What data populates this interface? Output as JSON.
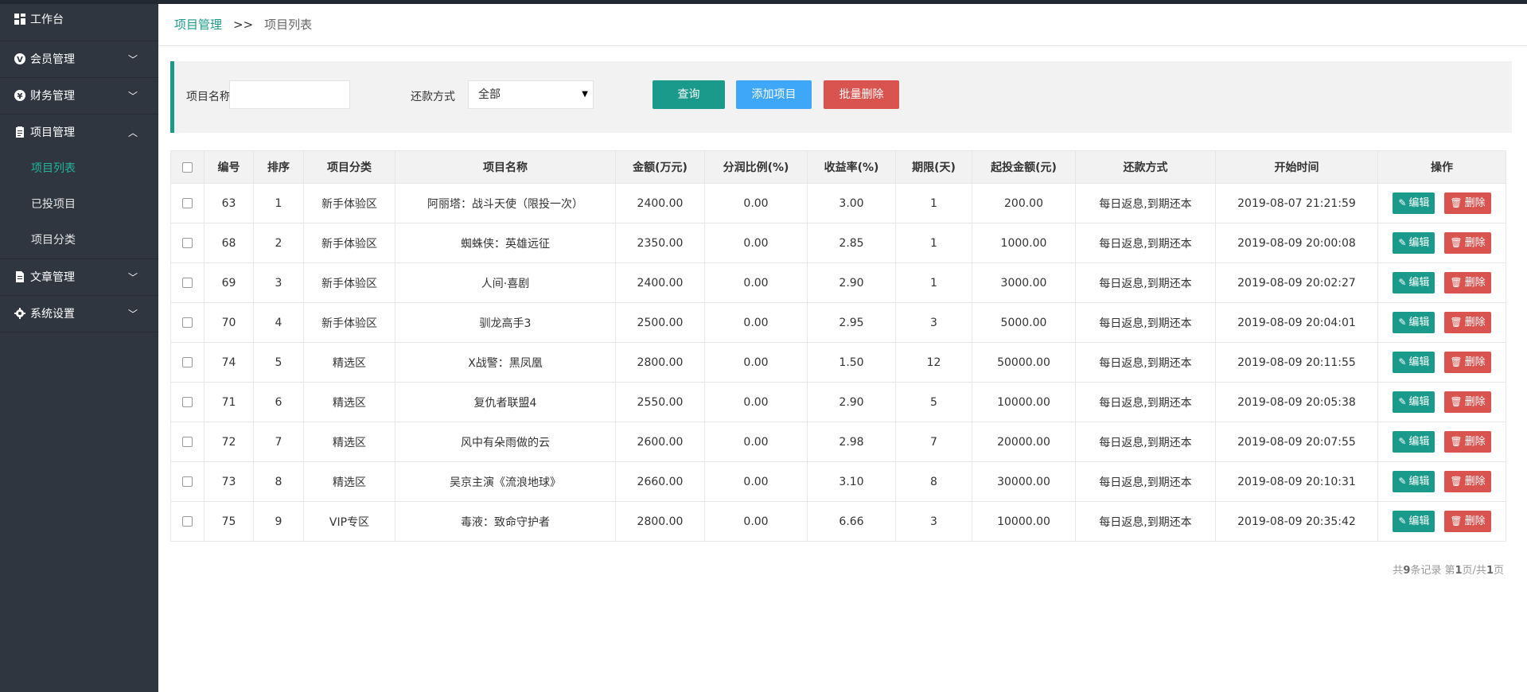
{
  "sidebar": {
    "items": [
      {
        "label": "工作台",
        "icon": "dashboard-icon"
      },
      {
        "label": "会员管理",
        "icon": "member-icon"
      },
      {
        "label": "财务管理",
        "icon": "finance-icon"
      },
      {
        "label": "项目管理",
        "icon": "clipboard-icon"
      },
      {
        "label": "文章管理",
        "icon": "file-icon"
      },
      {
        "label": "系统设置",
        "icon": "gear-icon"
      }
    ],
    "sub_items": [
      {
        "label": "项目列表"
      },
      {
        "label": "已投项目"
      },
      {
        "label": "项目分类"
      }
    ]
  },
  "breadcrumb": {
    "root": "项目管理",
    "sep": ">>",
    "current": "项目列表"
  },
  "filter": {
    "name_label": "项目名称",
    "name_value": "",
    "repay_label": "还款方式",
    "repay_value": "全部",
    "query": "查询",
    "add": "添加项目",
    "batch_delete": "批量删除"
  },
  "table": {
    "headers": [
      "编号",
      "排序",
      "项目分类",
      "项目名称",
      "金额(万元)",
      "分润比例(%)",
      "收益率(%)",
      "期限(天)",
      "起投金额(元)",
      "还款方式",
      "开始时间",
      "操作"
    ],
    "edit_label": "编辑",
    "delete_label": "删除",
    "rows": [
      [
        "63",
        "1",
        "新手体验区",
        "阿丽塔：战斗天使（限投一次）",
        "2400.00",
        "0.00",
        "3.00",
        "1",
        "200.00",
        "每日返息,到期还本",
        "2019-08-07 21:21:59"
      ],
      [
        "68",
        "2",
        "新手体验区",
        "蜘蛛侠：英雄远征",
        "2350.00",
        "0.00",
        "2.85",
        "1",
        "1000.00",
        "每日返息,到期还本",
        "2019-08-09 20:00:08"
      ],
      [
        "69",
        "3",
        "新手体验区",
        "人间·喜剧",
        "2400.00",
        "0.00",
        "2.90",
        "1",
        "3000.00",
        "每日返息,到期还本",
        "2019-08-09 20:02:27"
      ],
      [
        "70",
        "4",
        "新手体验区",
        "驯龙高手3",
        "2500.00",
        "0.00",
        "2.95",
        "3",
        "5000.00",
        "每日返息,到期还本",
        "2019-08-09 20:04:01"
      ],
      [
        "74",
        "5",
        "精选区",
        "X战警：黑凤凰",
        "2800.00",
        "0.00",
        "1.50",
        "12",
        "50000.00",
        "每日返息,到期还本",
        "2019-08-09 20:11:55"
      ],
      [
        "71",
        "6",
        "精选区",
        "复仇者联盟4",
        "2550.00",
        "0.00",
        "2.90",
        "5",
        "10000.00",
        "每日返息,到期还本",
        "2019-08-09 20:05:38"
      ],
      [
        "72",
        "7",
        "精选区",
        "风中有朵雨做的云",
        "2600.00",
        "0.00",
        "2.98",
        "7",
        "20000.00",
        "每日返息,到期还本",
        "2019-08-09 20:07:55"
      ],
      [
        "73",
        "8",
        "精选区",
        "吴京主演《流浪地球》",
        "2660.00",
        "0.00",
        "3.10",
        "8",
        "30000.00",
        "每日返息,到期还本",
        "2019-08-09 20:10:31"
      ],
      [
        "75",
        "9",
        "VIP专区",
        "毒液：致命守护者",
        "2800.00",
        "0.00",
        "6.66",
        "3",
        "10000.00",
        "每日返息,到期还本",
        "2019-08-09 20:35:42"
      ]
    ]
  },
  "pager": {
    "p1": "共",
    "total": "9",
    "p2": "条记录 第",
    "page": "1",
    "p3": "页/共",
    "pages": "1",
    "p4": "页"
  },
  "colors": {
    "accent": "#1a9a8a",
    "add": "#3ea7f7",
    "danger": "#d9534f",
    "sidebar": "#2f3640"
  }
}
